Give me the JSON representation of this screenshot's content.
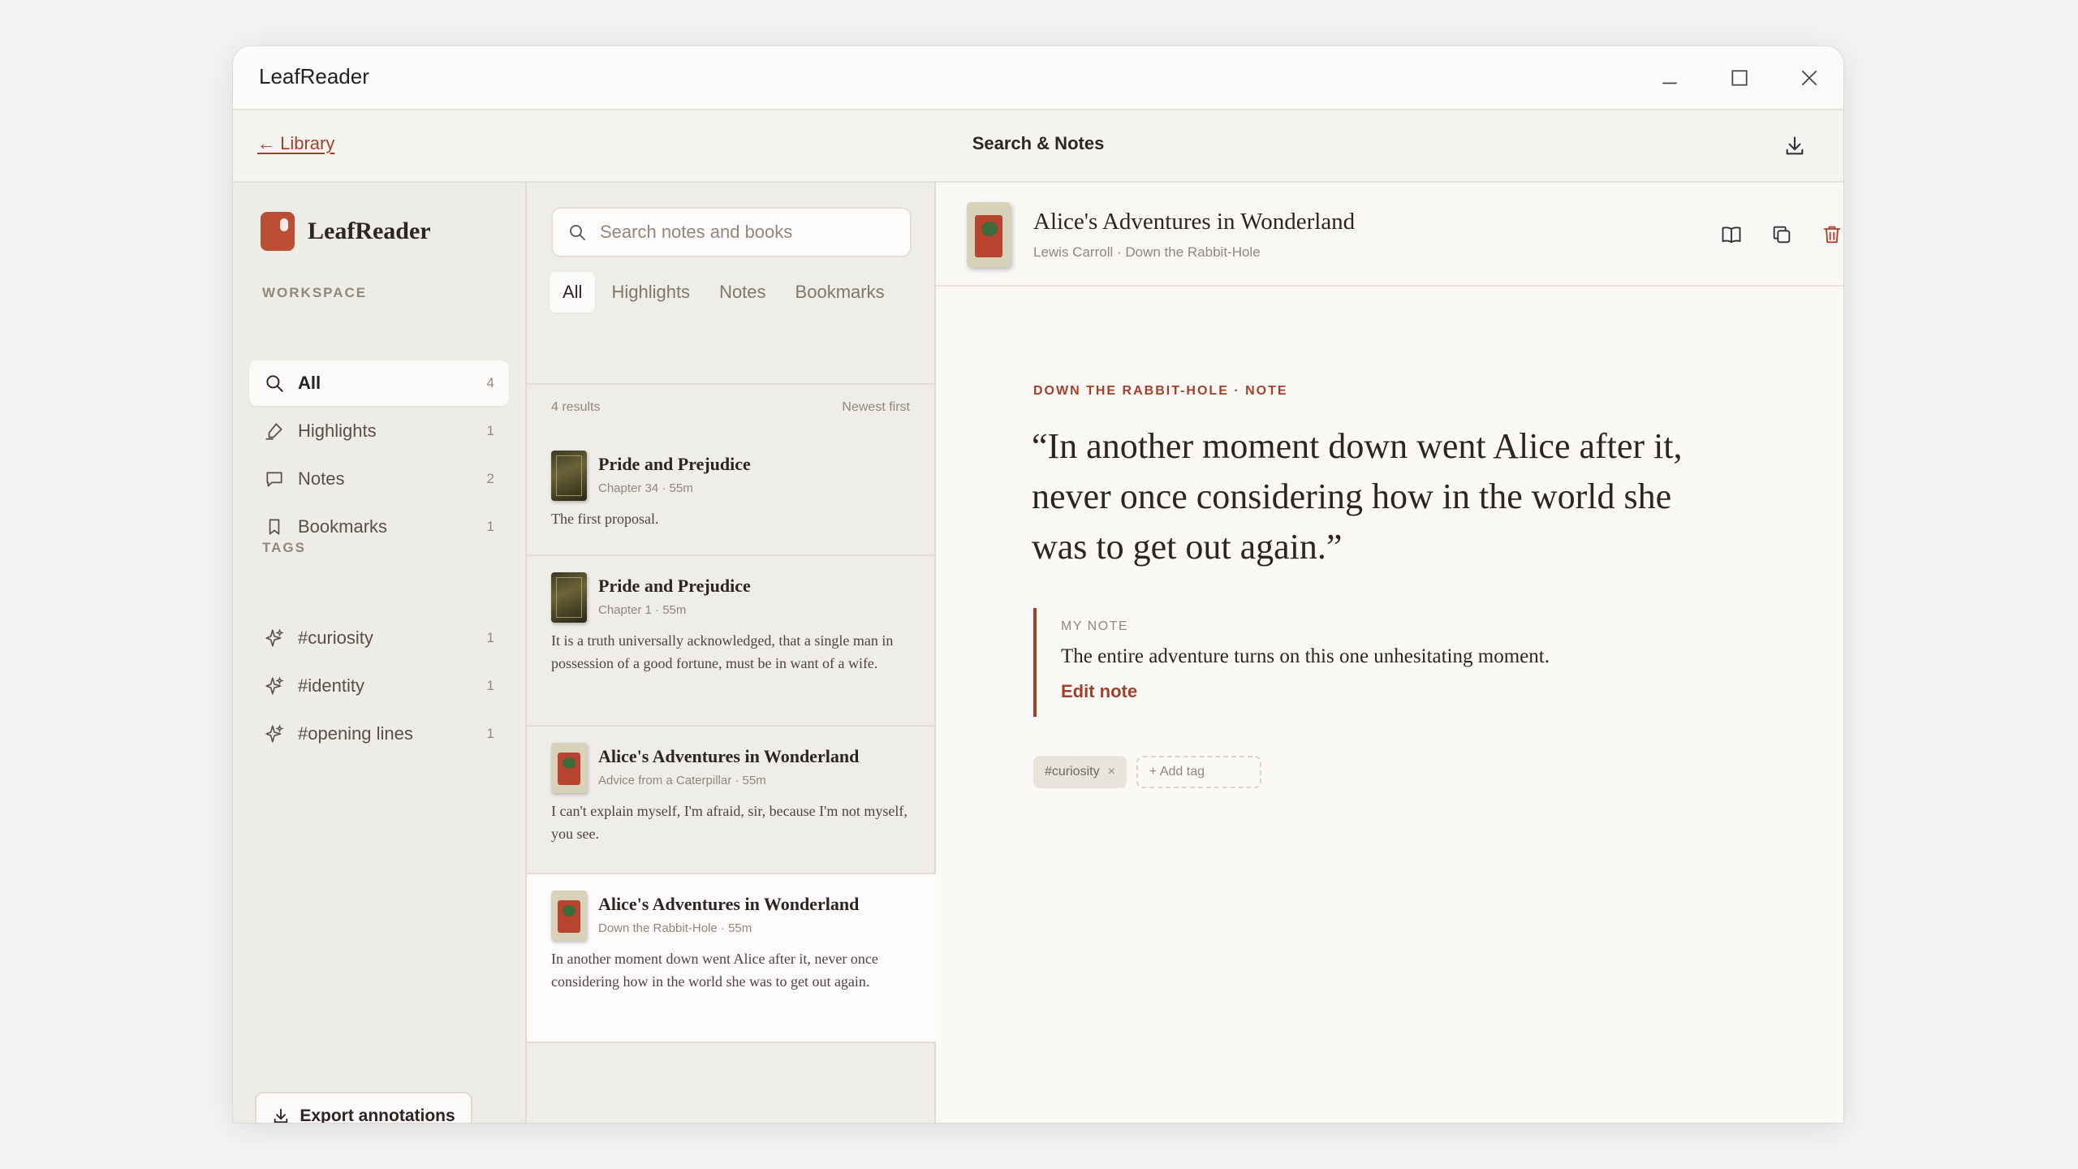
{
  "window": {
    "title": "LeafReader"
  },
  "header": {
    "back_label": "← Library",
    "title": "Search & Notes"
  },
  "sidebar": {
    "brand": "LeafReader",
    "workspace_label": "WORKSPACE",
    "tags_label": "TAGS",
    "items": [
      {
        "label": "All",
        "count": "4",
        "icon": "search-icon"
      },
      {
        "label": "Highlights",
        "count": "1",
        "icon": "highlighter-icon"
      },
      {
        "label": "Notes",
        "count": "2",
        "icon": "note-icon"
      },
      {
        "label": "Bookmarks",
        "count": "1",
        "icon": "bookmark-icon"
      }
    ],
    "tags": [
      {
        "label": "#curiosity",
        "count": "1",
        "icon": "sparkle-icon"
      },
      {
        "label": "#identity",
        "count": "1",
        "icon": "sparkle-icon"
      },
      {
        "label": "#opening lines",
        "count": "1",
        "icon": "sparkle-icon"
      }
    ],
    "export_label": "Export annotations"
  },
  "list": {
    "search_placeholder": "Search notes and books",
    "tabs": [
      "All",
      "Highlights",
      "Notes",
      "Bookmarks"
    ],
    "results_count": "4 results",
    "sort_label": "Newest first",
    "cards": [
      {
        "title": "Pride and Prejudice",
        "sub": "Chapter 34 · 55m",
        "text": "The first proposal."
      },
      {
        "title": "Pride and Prejudice",
        "sub": "Chapter 1 · 55m",
        "text": "It is a truth universally acknowledged, that a single man in possession of a good fortune, must be in want of a wife."
      },
      {
        "title": "Alice's Adventures in Wonderland",
        "sub": "Advice from a Caterpillar · 55m",
        "text": "I can't explain myself, I'm afraid, sir, because I'm not myself, you see."
      },
      {
        "title": "Alice's Adventures in Wonderland",
        "sub": "Down the Rabbit-Hole · 55m",
        "text": "In another moment down went Alice after it, never once considering how in the world she was to get out again."
      }
    ]
  },
  "detail": {
    "title": "Alice's Adventures in Wonderland",
    "sub": "Lewis Carroll · Down the Rabbit-Hole",
    "kicker": "DOWN THE RABBIT-HOLE · NOTE",
    "quote": "“In another moment down went Alice after it, never once considering how in the world she was to get out again.”",
    "note_label": "MY NOTE",
    "note_text": "The entire adventure turns on this one unhesitating moment.",
    "edit_label": "Edit note",
    "tag": "#curiosity",
    "tag_remove": "×",
    "add_tag": "+ Add tag"
  },
  "colors": {
    "accent": "#a2402c",
    "brand": "#bd4e36"
  }
}
